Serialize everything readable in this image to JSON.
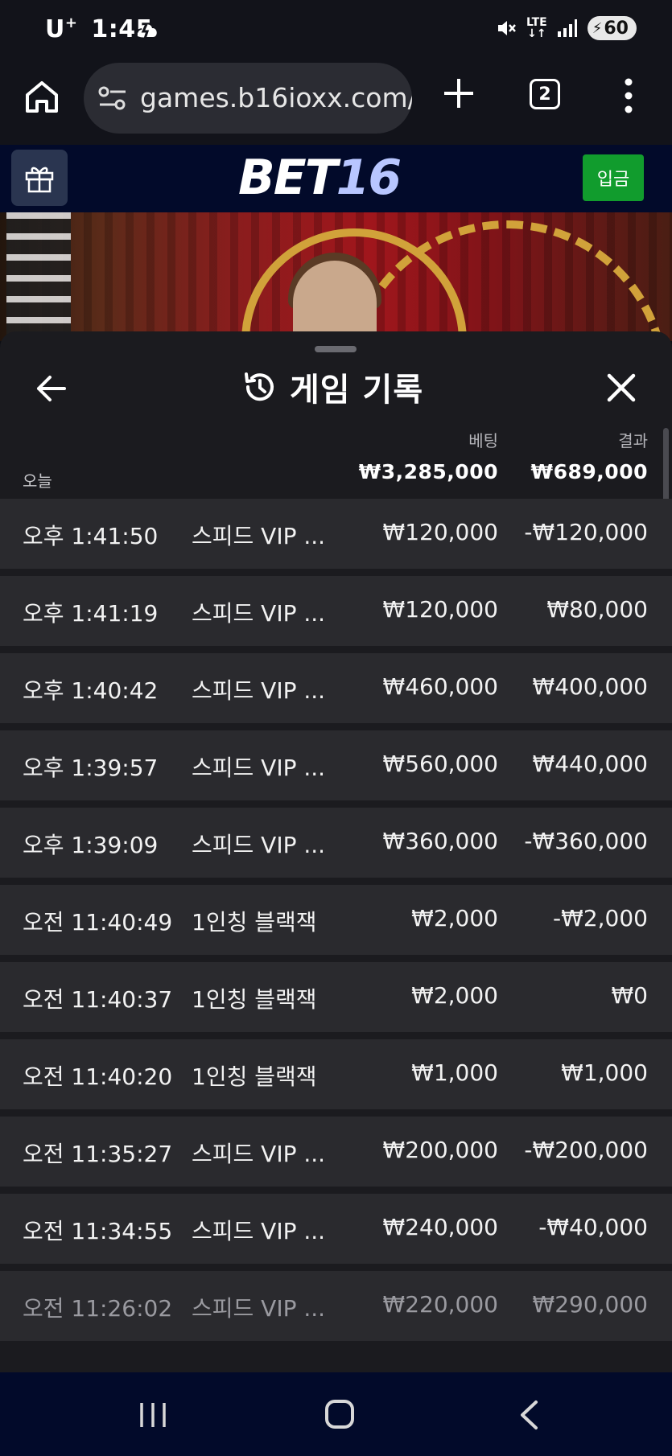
{
  "status_bar": {
    "carrier": "U",
    "carrier_sup": "+",
    "time": "1:45",
    "network": "LTE",
    "battery": "60"
  },
  "browser": {
    "url": "games.b16ioxx.com/",
    "tab_count": "2"
  },
  "site": {
    "logo_part1": "BET",
    "logo_part2": "16",
    "deposit_label": "입금"
  },
  "history": {
    "title": "게임 기록",
    "bet_header": "베팅",
    "result_header": "결과",
    "today_label": "오늘",
    "total_bet": "₩3,285,000",
    "total_result": "₩689,000",
    "rows": [
      {
        "time": "오후 1:41:50",
        "game": "스피드 VIP ...",
        "bet": "₩120,000",
        "result": "-₩120,000"
      },
      {
        "time": "오후 1:41:19",
        "game": "스피드 VIP ...",
        "bet": "₩120,000",
        "result": "₩80,000"
      },
      {
        "time": "오후 1:40:42",
        "game": "스피드 VIP ...",
        "bet": "₩460,000",
        "result": "₩400,000"
      },
      {
        "time": "오후 1:39:57",
        "game": "스피드 VIP ...",
        "bet": "₩560,000",
        "result": "₩440,000"
      },
      {
        "time": "오후 1:39:09",
        "game": "스피드 VIP ...",
        "bet": "₩360,000",
        "result": "-₩360,000"
      },
      {
        "time": "오전 11:40:49",
        "game": "1인칭 블랙잭",
        "bet": "₩2,000",
        "result": "-₩2,000"
      },
      {
        "time": "오전 11:40:37",
        "game": "1인칭 블랙잭",
        "bet": "₩2,000",
        "result": "₩0"
      },
      {
        "time": "오전 11:40:20",
        "game": "1인칭 블랙잭",
        "bet": "₩1,000",
        "result": "₩1,000"
      },
      {
        "time": "오전 11:35:27",
        "game": "스피드 VIP ...",
        "bet": "₩200,000",
        "result": "-₩200,000"
      },
      {
        "time": "오전 11:34:55",
        "game": "스피드 VIP ...",
        "bet": "₩240,000",
        "result": "-₩40,000"
      },
      {
        "time": "오전 11:26:02",
        "game": "스피드 VIP ...",
        "bet": "₩220,000",
        "result": "₩290,000"
      }
    ]
  },
  "colors": {
    "deposit_green": "#119c2d",
    "header_navy": "#020a2a",
    "sheet_bg": "#1b1b1f",
    "row_bg": "#2a2a2e"
  },
  "icons": [
    "home-icon",
    "site-settings-icon",
    "plus-icon",
    "tabs-icon",
    "more-vert-icon",
    "gift-icon",
    "back-arrow-icon",
    "history-icon",
    "close-icon",
    "recent-apps-icon",
    "home-nav-icon",
    "back-nav-icon"
  ]
}
